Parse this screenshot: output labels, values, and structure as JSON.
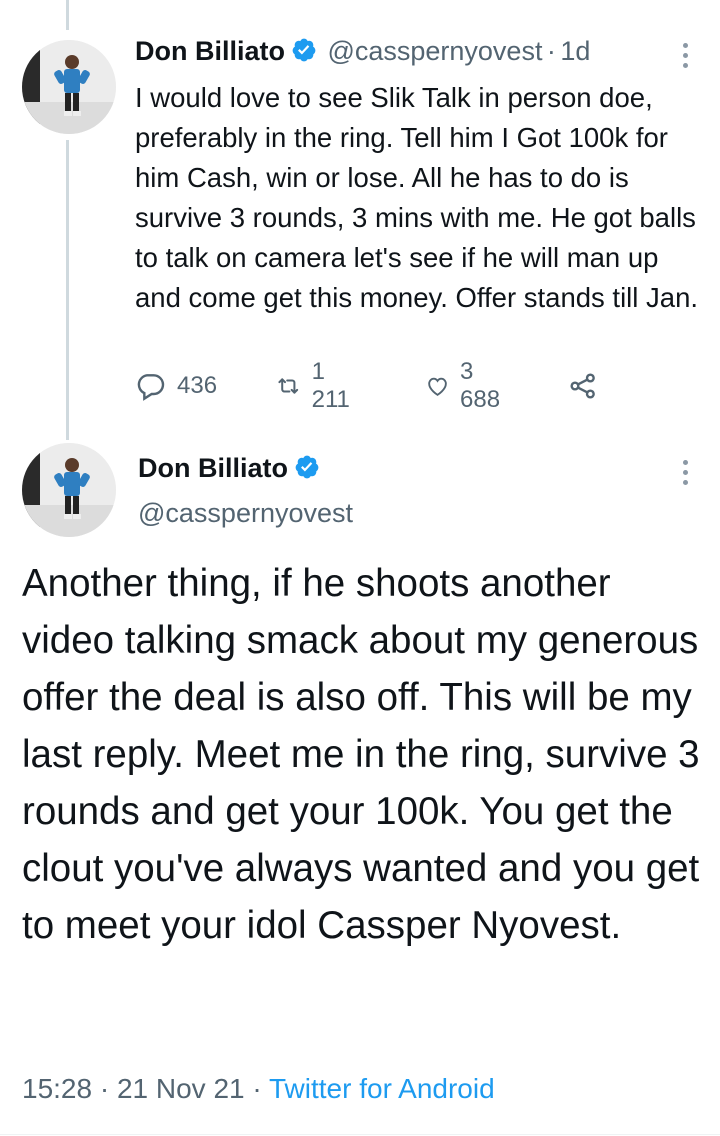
{
  "tweets": [
    {
      "name": "Don Billiato",
      "handle": "@casspernyovest",
      "separator": "·",
      "time_ago": "1d",
      "text": "I would love to see Slik Talk in person doe, preferably in the ring. Tell him I Got 100k for him Cash, win or lose. All he has to do is survive 3 rounds, 3 mins with me. He got balls to talk on camera let's see if he will man up and come get this money. Offer stands till Jan.",
      "replies": "436",
      "retweets": "1 211",
      "likes": "3 688"
    },
    {
      "name": "Don Billiato",
      "handle": "@casspernyovest",
      "text": "Another thing, if he shoots another video talking smack about my generous offer the deal is also off. This will be my last reply. Meet me in the ring, survive 3 rounds and get your 100k. You get the clout you've always wanted and you get to meet your idol Cassper Nyovest.",
      "time": "15:28",
      "dot1": "·",
      "date": "21 Nov 21",
      "dot2": "·",
      "source": "Twitter for Android"
    }
  ],
  "icons": {
    "verified": "verified-badge-icon",
    "more": "more-vertical-icon",
    "reply": "reply-icon",
    "retweet": "retweet-icon",
    "like": "like-icon",
    "share": "share-icon"
  },
  "colors": {
    "accent": "#1d9bf0",
    "secondary_text": "#536471",
    "thread_line": "#cfd9de"
  }
}
